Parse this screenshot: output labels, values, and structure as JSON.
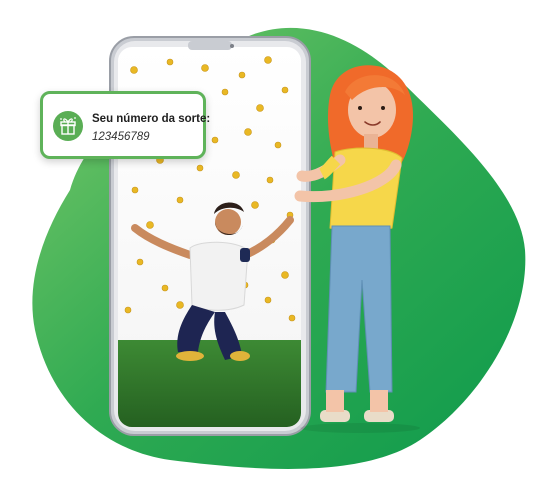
{
  "colors": {
    "blob_green": "#1aa650",
    "blob_green_light": "#5bbf55",
    "accent_green": "#5fb35a",
    "phone_frame": "#b9bcc2",
    "grass": "#2f7a2a",
    "coin": "#e9b824"
  },
  "lucky_card": {
    "title": "Seu número da sorte:",
    "number": "123456789",
    "icon": "gift-icon"
  }
}
